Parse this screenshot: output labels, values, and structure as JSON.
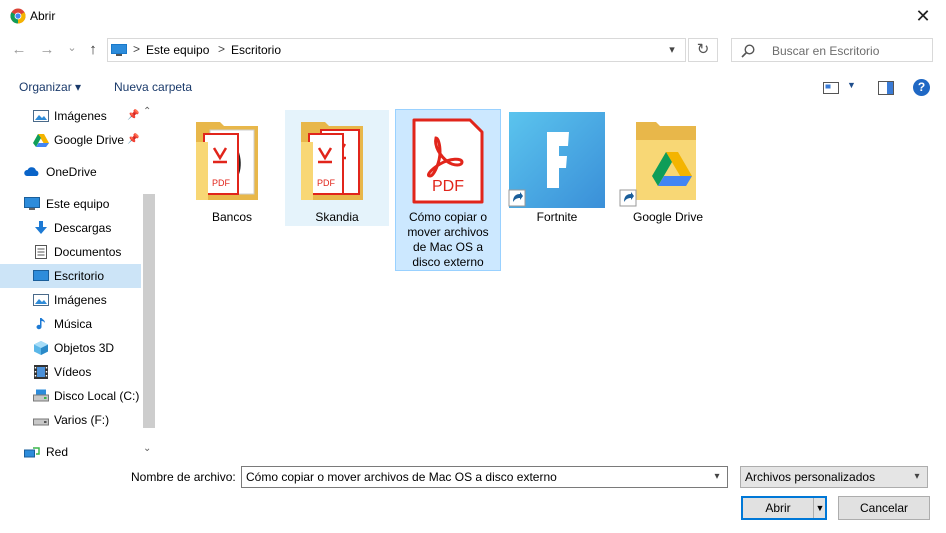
{
  "window": {
    "title": "Abrir",
    "close": "✕"
  },
  "nav": {
    "back": "←",
    "forward": "→",
    "recent": "⌄",
    "up": "↑",
    "breadcrumb": [
      "Este equipo",
      "Escritorio"
    ],
    "separator": ">",
    "refresh": "↻",
    "search_placeholder": "Buscar en Escritorio"
  },
  "toolbar": {
    "organize": "Organizar ▾",
    "new_folder": "Nueva carpeta",
    "help": "?"
  },
  "sidebar": {
    "items": [
      {
        "label": "Imágenes",
        "icon": "pictures-icon",
        "pinned": true
      },
      {
        "label": "Google Drive",
        "icon": "google-drive-icon",
        "pinned": true
      },
      {
        "label": "OneDrive",
        "icon": "onedrive-icon",
        "pinned": false
      },
      {
        "label": "Este equipo",
        "icon": "computer-icon",
        "pinned": false
      },
      {
        "label": "Descargas",
        "icon": "downloads-icon",
        "pinned": false
      },
      {
        "label": "Documentos",
        "icon": "documents-icon",
        "pinned": false
      },
      {
        "label": "Escritorio",
        "icon": "desktop-icon",
        "pinned": false,
        "selected": true
      },
      {
        "label": "Imágenes",
        "icon": "pictures-icon",
        "pinned": false
      },
      {
        "label": "Música",
        "icon": "music-icon",
        "pinned": false
      },
      {
        "label": "Objetos 3D",
        "icon": "3d-objects-icon",
        "pinned": false
      },
      {
        "label": "Vídeos",
        "icon": "videos-icon",
        "pinned": false
      },
      {
        "label": "Disco Local (C:)",
        "icon": "local-disk-icon",
        "pinned": false
      },
      {
        "label": "Varios (F:)",
        "icon": "drive-icon",
        "pinned": false
      },
      {
        "label": "Red",
        "icon": "network-icon",
        "pinned": false
      }
    ]
  },
  "files": [
    {
      "name": "Bancos",
      "type": "folder-pdf"
    },
    {
      "name": "Skandia",
      "type": "folder-pdf"
    },
    {
      "name": "Cómo copiar o mover archivos de Mac OS a disco externo",
      "name_lines": [
        "Cómo copiar o",
        "mover archivos",
        "de Mac OS a",
        "disco externo"
      ],
      "type": "pdf",
      "badge": "PDF"
    },
    {
      "name": "Fortnite",
      "type": "shortcut"
    },
    {
      "name": "Google Drive",
      "type": "folder-shortcut"
    }
  ],
  "bottom": {
    "filename_label": "Nombre de archivo:",
    "filename_value": "Cómo copiar o mover archivos de Mac OS a disco externo",
    "filetype_value": "Archivos personalizados",
    "open_label": "Abrir",
    "cancel_label": "Cancelar"
  },
  "colors": {
    "accent": "#0078d7",
    "pdf_red": "#e1251b",
    "folder": "#f8d775",
    "selection": "#cce8ff"
  }
}
